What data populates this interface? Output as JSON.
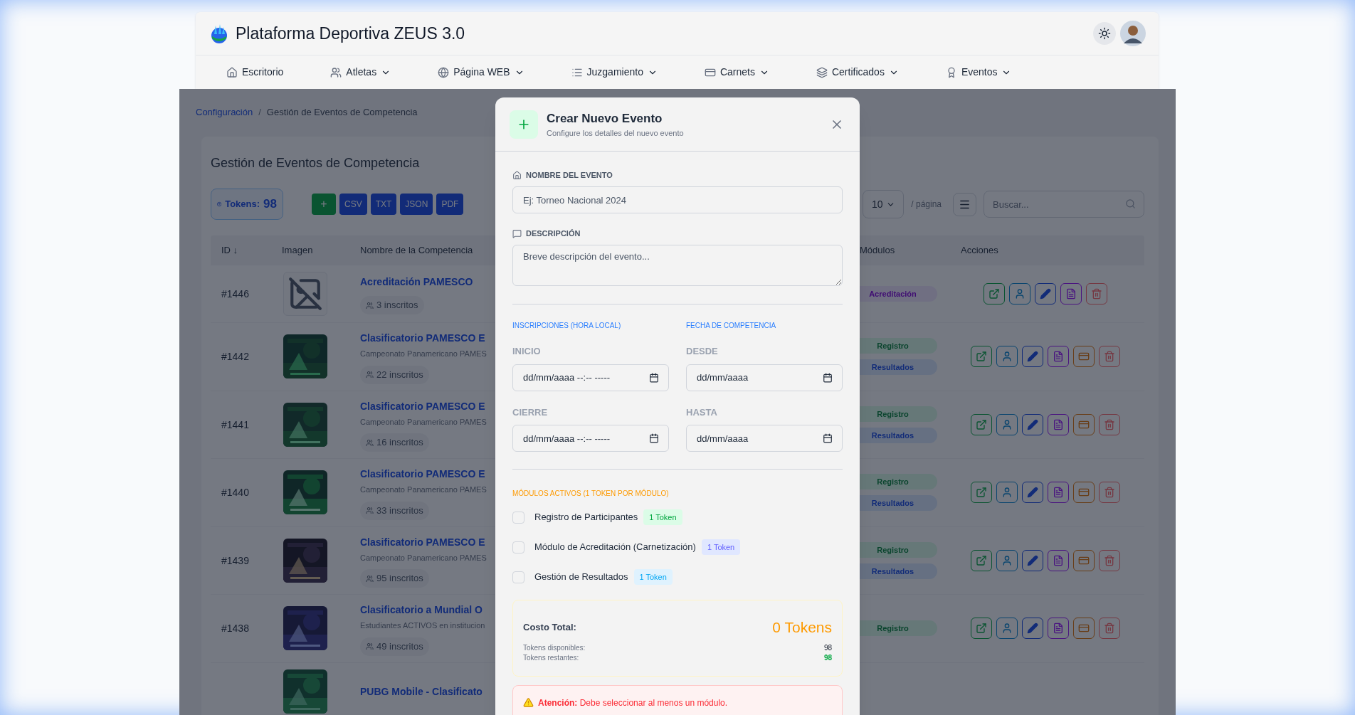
{
  "header": {
    "title": "Plataforma Deportiva ZEUS 3.0"
  },
  "nav": [
    {
      "label": "Escritorio",
      "kind": "home",
      "dropdown": false
    },
    {
      "label": "Atletas",
      "kind": "users",
      "dropdown": true
    },
    {
      "label": "Página WEB",
      "kind": "globe",
      "dropdown": true
    },
    {
      "label": "Juzgamiento",
      "kind": "list",
      "dropdown": true
    },
    {
      "label": "Carnets",
      "kind": "card",
      "dropdown": true
    },
    {
      "label": "Certificados",
      "kind": "layers",
      "dropdown": true
    },
    {
      "label": "Eventos",
      "kind": "award",
      "dropdown": true
    }
  ],
  "breadcrumb": {
    "parent": "Configuración",
    "separator": "/",
    "current": "Gestión de Eventos de Competencia"
  },
  "card_title": "Gestión de Eventos de Competencia",
  "toolbar": {
    "tokens_label": "Tokens:",
    "tokens_value": "98",
    "add_label": "+",
    "exports": [
      "CSV",
      "TXT",
      "JSON",
      "PDF"
    ],
    "page_size": "10",
    "page_suffix": "/ página",
    "search": {
      "placeholder": "Buscar..."
    }
  },
  "table": {
    "columns": [
      "ID ↓",
      "Imagen",
      "Nombre de la Competencia",
      "Módulos",
      "Acciones"
    ],
    "rows": [
      {
        "id": "#1446",
        "kind": "no_image",
        "name": "Acreditación PAMESCO",
        "inscritos": "3 inscritos",
        "modules": [
          {
            "label": "Acreditación",
            "kind": "acreditacion"
          }
        ],
        "actions": [
          {
            "kind": "open"
          },
          {
            "kind": "user"
          },
          {
            "kind": "edit"
          },
          {
            "kind": "doc"
          },
          {
            "kind": "delete"
          }
        ]
      },
      {
        "id": "#1442",
        "kind": "picture",
        "name": "Clasificatorio PAMESCO E",
        "subtitle": "Campeonato Panamericano PAMES",
        "inscritos": "22 inscritos",
        "modules": [
          {
            "label": "Registro",
            "kind": "registro"
          },
          {
            "label": "Resultados",
            "kind": "resultados"
          }
        ],
        "actions": [
          {
            "kind": "open"
          },
          {
            "kind": "user"
          },
          {
            "kind": "edit"
          },
          {
            "kind": "doc"
          },
          {
            "kind": "card"
          },
          {
            "kind": "delete"
          }
        ]
      },
      {
        "id": "#1441",
        "kind": "picture",
        "name": "Clasificatorio PAMESCO E",
        "subtitle": "Campeonato Panamericano PAMES",
        "inscritos": "16 inscritos",
        "modules": [
          {
            "label": "Registro",
            "kind": "registro"
          },
          {
            "label": "Resultados",
            "kind": "resultados"
          }
        ],
        "actions": [
          {
            "kind": "open"
          },
          {
            "kind": "user"
          },
          {
            "kind": "edit"
          },
          {
            "kind": "doc"
          },
          {
            "kind": "card"
          },
          {
            "kind": "delete"
          }
        ]
      },
      {
        "id": "#1440",
        "kind": "picture",
        "name": "Clasificatorio PAMESCO E",
        "subtitle": "Campeonato Panamericano PAMES",
        "inscritos": "33 inscritos",
        "modules": [
          {
            "label": "Registro",
            "kind": "registro"
          },
          {
            "label": "Resultados",
            "kind": "resultados"
          }
        ],
        "actions": [
          {
            "kind": "open"
          },
          {
            "kind": "user"
          },
          {
            "kind": "edit"
          },
          {
            "kind": "doc"
          },
          {
            "kind": "card"
          },
          {
            "kind": "delete"
          }
        ]
      },
      {
        "id": "#1439",
        "kind": "picture",
        "name": "Clasificatorio PAMESCO E",
        "subtitle": "Campeonato Panamericano PAMES",
        "inscritos": "95 inscritos",
        "modules": [
          {
            "label": "Registro",
            "kind": "registro"
          },
          {
            "label": "Resultados",
            "kind": "resultados"
          }
        ],
        "actions": [
          {
            "kind": "open"
          },
          {
            "kind": "user"
          },
          {
            "kind": "edit"
          },
          {
            "kind": "doc"
          },
          {
            "kind": "card"
          },
          {
            "kind": "delete"
          }
        ]
      },
      {
        "id": "#1438",
        "kind": "picture",
        "name": "Clasificatorio a Mundial O",
        "subtitle": "Estudiantes ACTIVOS en institucion",
        "inscritos": "49 inscritos",
        "modules": [
          {
            "label": "Registro",
            "kind": "registro"
          }
        ],
        "actions": [
          {
            "kind": "open"
          },
          {
            "kind": "user"
          },
          {
            "kind": "edit"
          },
          {
            "kind": "doc"
          },
          {
            "kind": "card"
          },
          {
            "kind": "delete"
          }
        ]
      },
      {
        "kind": "picture",
        "name": "PUBG Mobile - Clasificato"
      }
    ]
  },
  "modal": {
    "title": "Crear Nuevo Evento",
    "subtitle": "Configure los detalles del nuevo evento",
    "name_label": "NOMBRE DEL EVENTO",
    "name_placeholder": "Ej: Torneo Nacional 2024",
    "description_label": "DESCRIPCIÓN",
    "description_placeholder": "Breve descripción del evento...",
    "sections": [
      {
        "title": "INSCRIPCIONES (HORA LOCAL)",
        "fields": [
          {
            "label": "INICIO",
            "placeholder": "dd/mm/aaaa --:-- -----"
          },
          {
            "label": "CIERRE",
            "placeholder": "dd/mm/aaaa --:-- -----"
          }
        ]
      },
      {
        "title": "FECHA DE COMPETENCIA",
        "fields": [
          {
            "label": "DESDE",
            "placeholder": "dd/mm/aaaa"
          },
          {
            "label": "HASTA",
            "placeholder": "dd/mm/aaaa"
          }
        ]
      }
    ],
    "modules_title": "MÓDULOS ACTIVOS (1 TOKEN POR MÓDULO)",
    "modules": [
      {
        "label": "Registro de Participantes",
        "badge": "1 Token",
        "kind": "registro",
        "checked": false
      },
      {
        "label": "Módulo de Acreditación (Carnetización)",
        "badge": "1 Token",
        "kind": "acreditacion",
        "checked": false
      },
      {
        "label": "Gestión de Resultados",
        "badge": "1 Token",
        "kind": "resultados",
        "checked": false
      }
    ],
    "cost": {
      "label": "Costo Total:",
      "value": "0 Tokens",
      "available_label": "Tokens disponibles:",
      "available": "98",
      "remaining_label": "Tokens restantes:",
      "remaining": "98"
    },
    "alert": "**Atención:** Debe seleccionar al menos un módulo."
  }
}
